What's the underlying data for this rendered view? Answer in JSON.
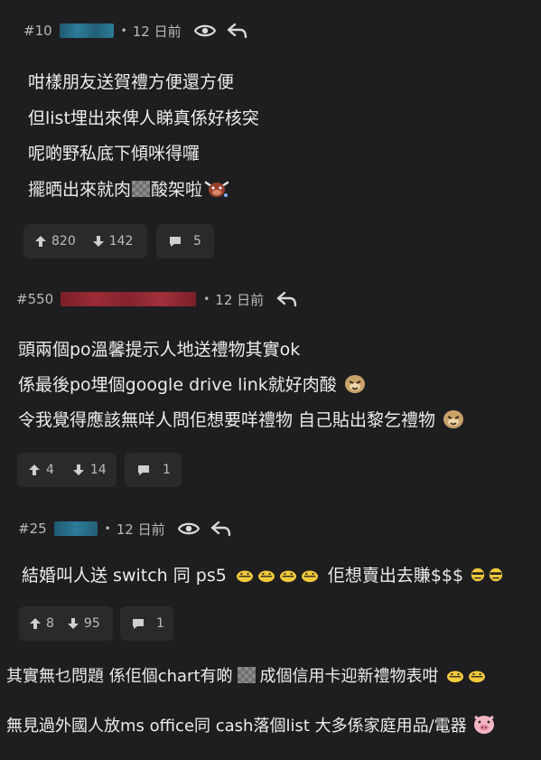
{
  "posts": [
    {
      "number": "#10",
      "dot": "•",
      "time": "12 日前",
      "lines": [
        "咁樣朋友送賀禮方便還方便",
        "但list埋出來俾人睇真係好核突",
        "呢啲野私底下傾咪得囉",
        "擺晒出來就肉",
        "酸架啦"
      ],
      "upvotes": "820",
      "downvotes": "142",
      "comments": "5"
    },
    {
      "number": "#550",
      "dot": "•",
      "time": "12 日前",
      "lines": [
        "頭兩個po溫馨提示人地送禮物其實ok",
        "係最後po埋個google drive link就好肉酸",
        "令我覺得應該無咩人問佢想要咩禮物 自己貼出黎乞禮物"
      ],
      "upvotes": "4",
      "downvotes": "14",
      "comments": "1"
    },
    {
      "number": "#25",
      "dot": "•",
      "time": "12 日前",
      "lines": [
        "結婚叫人送 switch 同 ps5",
        "佢想賣出去賺$$$"
      ],
      "upvotes": "8",
      "downvotes": "95",
      "comments": "1"
    }
  ],
  "tail": {
    "line1a": "其實無乜問題 係佢個chart有啲",
    "line1b": "成個信用卡迎新禮物表咁",
    "line2": "無見過外國人放ms office同 cash落個list 大多係家庭用品/電器"
  },
  "icons": {
    "view": "eye-icon",
    "reply": "reply-icon",
    "upvote": "arrow-up-icon",
    "downvote": "arrow-down-icon",
    "comment": "comment-bubble-icon"
  },
  "colors": {
    "background": "#1e1e20",
    "button": "#2a2a2c",
    "username_blur_1": "#2b7c9a",
    "username_blur_2": "#9b2b36",
    "username_blur_3": "#2b7c9a"
  }
}
